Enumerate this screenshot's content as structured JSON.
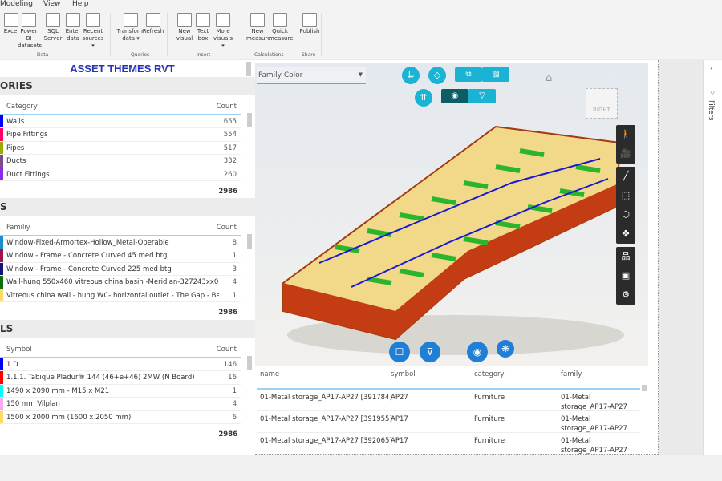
{
  "menu": [
    "Modeling",
    "View",
    "Help"
  ],
  "ribbon": {
    "buttons": [
      {
        "label": "Excel",
        "icon": "excel-icon"
      },
      {
        "label": "Power BI\ndatasets",
        "icon": "powerbi-datasets-icon"
      },
      {
        "label": "SQL\nServer",
        "icon": "sql-server-icon"
      },
      {
        "label": "Enter\ndata",
        "icon": "enter-data-icon"
      },
      {
        "label": "Recent\nsources ▾",
        "icon": "recent-sources-icon"
      },
      {
        "label": "Transform\ndata ▾",
        "icon": "transform-data-icon"
      },
      {
        "label": "Refresh",
        "icon": "refresh-icon"
      },
      {
        "label": "New\nvisual",
        "icon": "new-visual-icon"
      },
      {
        "label": "Text\nbox",
        "icon": "text-box-icon"
      },
      {
        "label": "More\nvisuals ▾",
        "icon": "more-visuals-icon"
      },
      {
        "label": "New\nmeasure",
        "icon": "new-measure-icon"
      },
      {
        "label": "Quick\nmeasure",
        "icon": "quick-measure-icon"
      },
      {
        "label": "Publish",
        "icon": "publish-icon"
      }
    ],
    "groups": [
      "Data",
      "Queries",
      "Insert",
      "Calculations",
      "Share"
    ]
  },
  "report": {
    "title": "ASSET THEMES RVT"
  },
  "categories": {
    "section": "ORIES",
    "col1": "Category",
    "col2": "Count",
    "total": "2986",
    "rows": [
      {
        "label": "Walls",
        "count": "655",
        "color": "#0000ff"
      },
      {
        "label": "Pipe Fittings",
        "count": "554",
        "color": "#ff0066"
      },
      {
        "label": "Pipes",
        "count": "517",
        "color": "#99aa00"
      },
      {
        "label": "Ducts",
        "count": "332",
        "color": "#7a4a8a"
      },
      {
        "label": "Duct Fittings",
        "count": "260",
        "color": "#8a2be2"
      }
    ]
  },
  "families": {
    "section": "S",
    "col1": "Familiy",
    "col2": "Count",
    "total": "2986",
    "rows": [
      {
        "label": "Window-Fixed-Armortex-Hollow_Metal-Operable",
        "count": "8",
        "color": "#1a8fc9"
      },
      {
        "label": "Window - Frame - Concrete Curved 45 med btg",
        "count": "1",
        "color": "#a0124a"
      },
      {
        "label": "Window - Frame - Concrete Curved 225 med btg",
        "count": "3",
        "color": "#141478"
      },
      {
        "label": "Wall-hung 550x460 vitreous china basin -Meridian-327243xx0",
        "count": "4",
        "color": "#0a6e0a"
      },
      {
        "label": "Vitreous china wall - hung WC- horizontal outlet - The Gap - Base - 246477xx0",
        "count": "1",
        "color": "#ffd966"
      }
    ]
  },
  "symbols": {
    "section": "LS",
    "col1": "Symbol",
    "col2": "Count",
    "total": "2986",
    "rows": [
      {
        "label": "1 D",
        "count": "146",
        "color": "#0000ff"
      },
      {
        "label": "1.1.1. Tabique Pladur® 144 (46+e+46) 2MW (N Board)",
        "count": "16",
        "color": "#ff0000"
      },
      {
        "label": "1490 x 2090 mm - M15 x M21",
        "count": "1",
        "color": "#00ffff"
      },
      {
        "label": "150 mm Vilplan",
        "count": "4",
        "color": "#ffaaee"
      },
      {
        "label": "1500 x 2000 mm (1600 x 2050 mm)",
        "count": "6",
        "color": "#ffd966"
      }
    ]
  },
  "viewer": {
    "color_by": "Family Color",
    "viewcube_label": "RIGHT",
    "accent": "#1bb3d3",
    "bottom_accent": "#1f7fd6"
  },
  "grid": {
    "columns": [
      "name",
      "symbol",
      "category",
      "family"
    ],
    "rows": [
      {
        "name": "01-Metal storage_AP17-AP27 [391784]",
        "symbol": "AP27",
        "category": "Furniture",
        "family": "01-Metal storage_AP17-AP27"
      },
      {
        "name": "01-Metal storage_AP17-AP27 [391955]",
        "symbol": "AP17",
        "category": "Furniture",
        "family": "01-Metal storage_AP17-AP27"
      },
      {
        "name": "01-Metal storage_AP17-AP27 [392065]",
        "symbol": "AP17",
        "category": "Furniture",
        "family": "01-Metal storage_AP17-AP27"
      }
    ]
  },
  "filters": {
    "label": "Filters"
  }
}
